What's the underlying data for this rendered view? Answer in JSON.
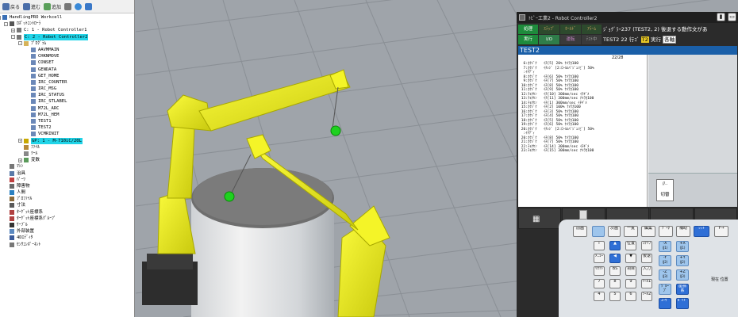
{
  "toolbar": {
    "back_label": "戻る",
    "forward_label": "進む",
    "add_label": "追加"
  },
  "tree": {
    "items": [
      {
        "label": "HandlingPRO Workcell",
        "level": 0,
        "icon": "workcell-icon",
        "expander": "-"
      },
      {
        "label": "ﾛﾎﾞｯﾄｺﾝﾄﾛｰﾗ",
        "level": 1,
        "icon": "controller-group-icon",
        "expander": "-"
      },
      {
        "label": "C: 1 - Robot Controller1",
        "level": 2,
        "icon": "controller-icon",
        "expander": "+"
      },
      {
        "label": "C: 2 - Robot Controller2",
        "level": 2,
        "icon": "controller-icon",
        "expander": "-",
        "highlight": true
      },
      {
        "label": "ﾌﾟﾛｸﾞﾗﾑ",
        "level": 3,
        "icon": "folder-icon",
        "expander": "-"
      },
      {
        "label": "AAVMMAIN",
        "level": 4,
        "icon": "program-icon"
      },
      {
        "label": "CHKNMOVE",
        "level": 4,
        "icon": "program-icon"
      },
      {
        "label": "CONSET",
        "level": 4,
        "icon": "program-icon"
      },
      {
        "label": "GENDATA",
        "level": 4,
        "icon": "program-icon"
      },
      {
        "label": "GET_HOME",
        "level": 4,
        "icon": "program-icon"
      },
      {
        "label": "IRC_COUNTER",
        "level": 4,
        "icon": "program-icon"
      },
      {
        "label": "IRC_MSG",
        "level": 4,
        "icon": "program-icon"
      },
      {
        "label": "IRC_STATUS",
        "level": 4,
        "icon": "program-icon"
      },
      {
        "label": "IRC_STLABEL",
        "level": 4,
        "icon": "program-icon"
      },
      {
        "label": "M72L_ARC",
        "level": 4,
        "icon": "program-icon"
      },
      {
        "label": "M72L_HEM",
        "level": 4,
        "icon": "program-icon"
      },
      {
        "label": "TEST1",
        "level": 4,
        "icon": "program-icon"
      },
      {
        "label": "TEST2",
        "level": 4,
        "icon": "program-icon"
      },
      {
        "label": "VCMRINIT",
        "level": 4,
        "icon": "program-icon"
      },
      {
        "label": "GP: 1 - M-710iC/20L",
        "level": 3,
        "icon": "robot-icon",
        "expander": "+",
        "highlight": true
      },
      {
        "label": "ﾌｧｲﾙ",
        "level": 3,
        "icon": "file-icon"
      },
      {
        "label": "ﾂｰﾙ",
        "level": 3,
        "icon": "tool-icon"
      },
      {
        "label": "変数",
        "level": 3,
        "icon": "variable-icon",
        "expander": "+"
      },
      {
        "label": "ﾏｼﾝ",
        "level": 1,
        "icon": "machine-icon"
      },
      {
        "label": "治具",
        "level": 1,
        "icon": "fixture-icon"
      },
      {
        "label": "ﾊﾟｰﾂ",
        "level": 1,
        "icon": "parts-icon"
      },
      {
        "label": "障害物",
        "level": 1,
        "icon": "obstacle-icon"
      },
      {
        "label": "人間",
        "level": 1,
        "icon": "human-icon"
      },
      {
        "label": "ﾌﾟﾛﾌｧｲﾙ",
        "level": 1,
        "icon": "profile-icon"
      },
      {
        "label": "寸法",
        "level": 1,
        "icon": "dimension-icon"
      },
      {
        "label": "ﾀｰｹﾞｯﾄ座標系",
        "level": 1,
        "icon": "target-frame-icon"
      },
      {
        "label": "ﾀｰｹﾞｯﾄ座標系ｸﾞﾙｰﾌﾟ",
        "level": 1,
        "icon": "target-group-icon"
      },
      {
        "label": "ｹｰﾌﾞﾙ",
        "level": 1,
        "icon": "cable-icon"
      },
      {
        "label": "外部装置",
        "level": 1,
        "icon": "external-device-icon"
      },
      {
        "label": "4Dｴﾃﾞｨﾀ",
        "level": 1,
        "icon": "4d-editor-icon"
      },
      {
        "label": "ｾﾝｻｺﾝﾎﾟｰﾈﾝﾄ",
        "level": 1,
        "icon": "sensor-icon"
      }
    ]
  },
  "pendant": {
    "title": "ﾄﾋﾟｰ工業2 - Robot Controller2",
    "status": {
      "row1": [
        "処理",
        "ｽﾃｯﾌﾟ",
        "ﾎｰﾙﾄﾞ",
        "ｱﾗｰﾑ"
      ],
      "row2": [
        "実行",
        "I/O",
        "運転",
        "ﾃｽﾄ中"
      ]
    },
    "message": "ｼﾞｮｸﾞﾗｰ237 (TEST2, 2) 後退する動作文があ",
    "info_prefix": "TEST2 22 行ｺﾞ",
    "info_t2": "T2",
    "info_run": "実行",
    "info_pct": "各軸",
    "program_name": "TEST2",
    "line_count": "22/28",
    "lines": [
      "  6:ｶｸｼﾞｸ   ｲﾁ[5] 20% ﾅﾒﾗｶ100",
      "  7:ｶｸｼﾞｸ   ｲﾁﾚｼﾞ [2:ﾛｰﾙﾑﾍﾟｼﾞｭﾝﾋﾞ] 50%",
      "  :ｲﾁﾃﾞｨ",
      "  8:ｶｸｼﾞｸ   ｲﾁ[6] 50% ﾅﾒﾗｶ100",
      "  9:ｶｸｼﾞｸ   ｲﾁ[7] 50% ﾅﾒﾗｶ100",
      " 10:ｶｸｼﾞｸ   ｲﾁ[8] 50% ﾅﾒﾗｶ100",
      " 11:ｶｸｼﾞｸ   ｲﾁ[9] 50% ﾅﾒﾗｶ100",
      " 12:ﾁｮｸｾﾝ   ｲﾁ[10] 300mm/sec ｲﾁｷﾞﾒ",
      " 13:ﾁｮｸｾﾝ   ｲﾁ[11] 300mm/sec ﾅﾒﾗｶ100",
      " 14:ﾁｮｸｾﾝ   ｲﾁ[1] 300mm/sec ｲﾁｷﾞﾒ",
      " 15:ｶｸｼﾞｸ   ｲﾁ[2] 100% ﾅﾒﾗｶ100",
      " 16:ｶｸｼﾞｸ   ｲﾁ[3] 50% ﾅﾒﾗｶ100",
      " 17:ｶｸｼﾞｸ   ｲﾁ[4] 50% ﾅﾒﾗｶ100",
      " 18:ｶｸｼﾞｸ   ｲﾁ[5] 50% ﾅﾒﾗｶ100",
      " 19:ｶｸｼﾞｸ   ｲﾁ[6] 50% ﾅﾒﾗｶ100",
      " 20:ｶｸｼﾞｸ   ｲﾁﾚｼﾞ [2:ﾛｰﾙﾑﾍﾟｼﾞｭﾝﾋﾞ] 50%",
      "  :ｲﾁﾃﾞｨ",
      " 20:ｶｸｼﾞｸ   ｲﾁ[8] 50% ﾅﾒﾗｶ100",
      " 21:ｶｸｼﾞｸ   ｲﾁ[7] 50% ﾅﾒﾗｶ100",
      " 22:ﾁｮｸｾﾝ   ｲﾁ[14] 300mm/sec ｲﾁｷﾞﾒ",
      " 23:ﾁｮｸｾﾝ   ｲﾁ[15] 300mm/sec ﾅﾒﾗｶ100"
    ],
    "current_line_index": 19,
    "side_button": {
      "top": "//..",
      "bottom": "切替"
    },
    "fkey_confirm": "確認",
    "keypad": {
      "prev": "前画",
      "next": "次画",
      "item": "一覧",
      "edit": "編集",
      "data": "ﾃﾞｰﾀ",
      "assist": "補助",
      "shift": "ｼﾌﾄ",
      "fwd": "F→",
      "info": "i",
      "menu": "ﾒﾆｭｰ",
      "enter": "入力",
      "confirm": "確認",
      "pos": "位置",
      "back": "後退",
      "fore": "前進",
      "step": "ｽﾃｯﾌ",
      "reset": "ﾘｾｯﾄ",
      "bs": "BS",
      "item2": "項目",
      "pos_disp": "位置表示",
      "tool": "ﾂｰﾙ",
      "coord": "座標系",
      "user": "ﾕｰｻﾞ",
      "num7": "7",
      "num8": "8",
      "num9": "9",
      "num4": "4",
      "num5": "5",
      "num6": "6",
      "jog_x_minus": "-X",
      "jog_x_plus": "+X",
      "jog_y_minus": "-Y",
      "jog_y_plus": "+Y",
      "jog_z_minus": "-Z",
      "jog_z_plus": "+Z",
      "jog_j1": "(J1)",
      "jog_j2": "(J2)",
      "jog_j3": "(J3)",
      "grp": "ｸﾞﾙｰﾌﾟ",
      "tool1": "ﾂｰﾙ1",
      "tool2": "ﾂｰﾙ2",
      "fn1": "ｶﾞｲﾄﾞ",
      "present": "現在\n位置"
    }
  },
  "scene": {
    "floor_color": "#9ea3a9",
    "robot_color": "#e6e620",
    "target_color": "#1ed11e",
    "pedestal_color": "#d8d8d8"
  }
}
